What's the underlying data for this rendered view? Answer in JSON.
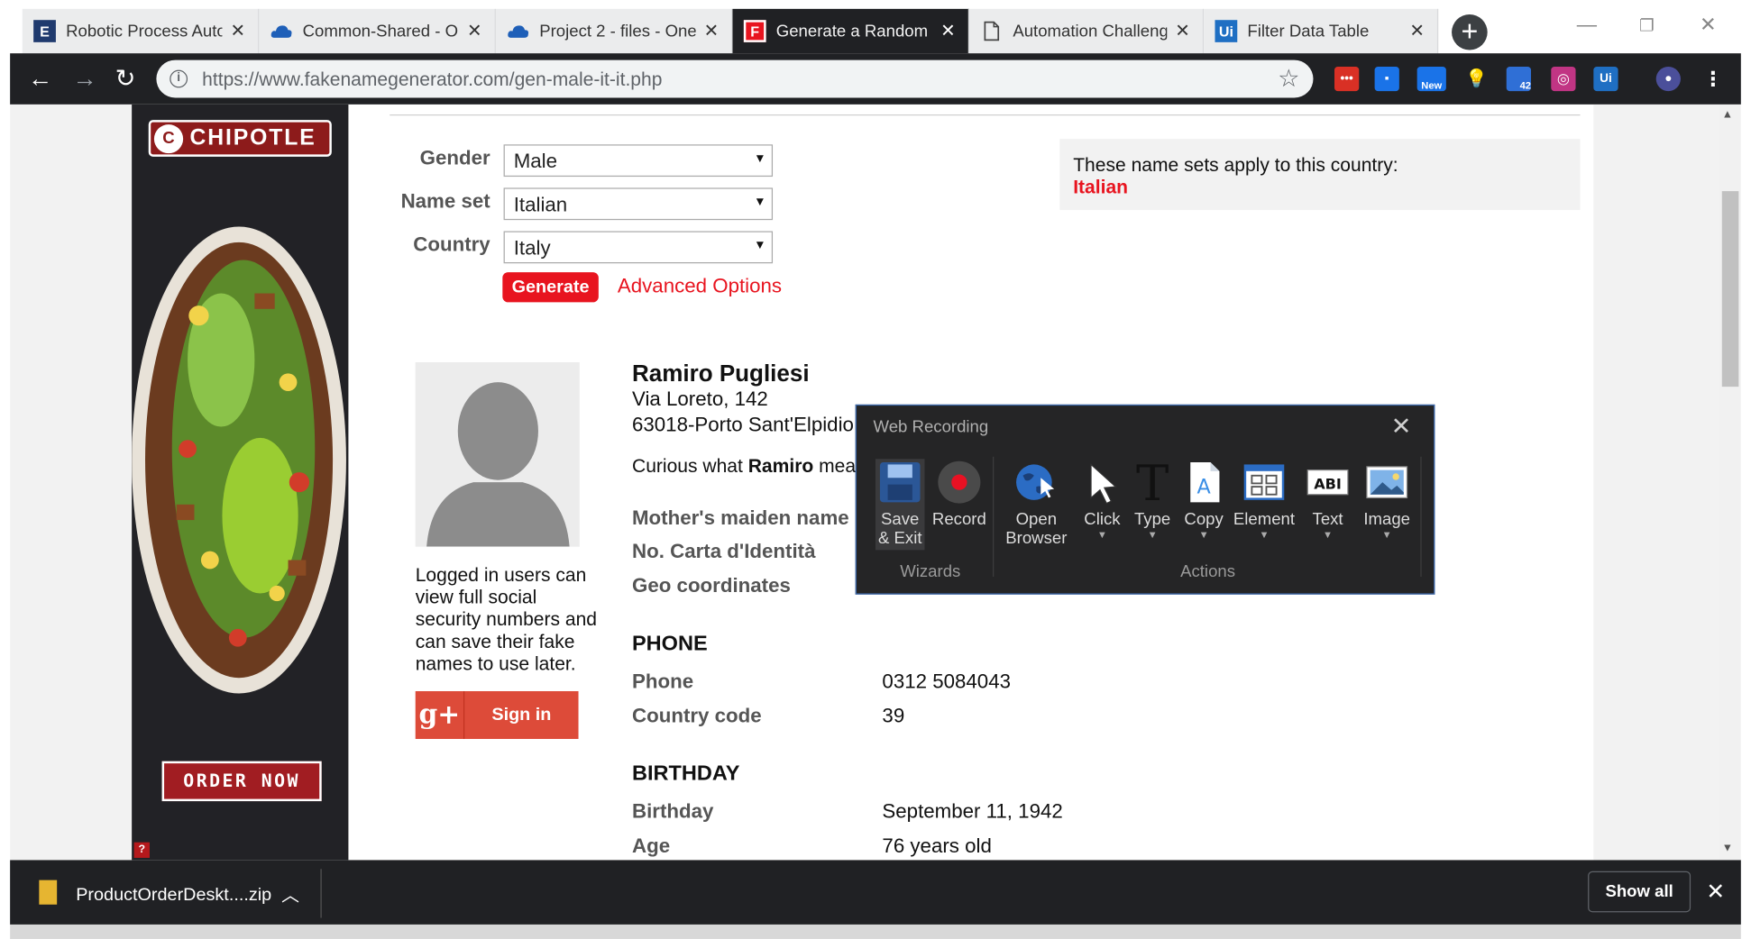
{
  "browser": {
    "tabs": [
      {
        "icon": "E",
        "title": "Robotic Process Auto",
        "active": false
      },
      {
        "icon": "cloud",
        "title": "Common-Shared - O",
        "active": false
      },
      {
        "icon": "cloud",
        "title": "Project 2 - files - One",
        "active": false
      },
      {
        "icon": "F",
        "title": "Generate a Random",
        "active": true
      },
      {
        "icon": "doc",
        "title": "Automation Challeng",
        "active": false
      },
      {
        "icon": "Ui",
        "title": "Filter Data Table",
        "active": false
      }
    ],
    "url_host": "https://www.fakenamegenerator.com",
    "url_path": "/gen-male-it-it.php",
    "ext_badges": {
      "new": "New",
      "count": "42",
      "ui": "Ui"
    }
  },
  "ad": {
    "brand": "CHIPOTLE",
    "cta": "ORDER NOW",
    "badge": "?"
  },
  "form": {
    "gender_label": "Gender",
    "gender_value": "Male",
    "nameset_label": "Name set",
    "nameset_value": "Italian",
    "country_label": "Country",
    "country_value": "Italy",
    "generate_label": "Generate",
    "advanced_label": "Advanced Options"
  },
  "info_box": {
    "line1": "These name sets apply to this country:",
    "line2": "Italian"
  },
  "sidebar": {
    "logged_text": "Logged in users can view full social security numbers and can save their fake names to use later.",
    "signin_label": "Sign in",
    "gplus_mark": "g+"
  },
  "person": {
    "name": "Ramiro Pugliesi",
    "address1": "Via Loreto, 142",
    "address2": "63018-Porto Sant'Elpidio",
    "curious_prefix": "Curious what ",
    "curious_name": "Ramiro",
    "curious_suffix": " mea",
    "rows": [
      {
        "label": "Mother's maiden name"
      },
      {
        "label": "No. Carta d'Identità"
      },
      {
        "label": "Geo coordinates"
      }
    ],
    "phone_heading": "PHONE",
    "phone_label": "Phone",
    "phone_value": "0312 5084043",
    "cc_label": "Country code",
    "cc_value": "39",
    "birthday_heading": "BIRTHDAY",
    "birthday_label": "Birthday",
    "birthday_value": "September 11, 1942",
    "age_label": "Age",
    "age_value": "76 years old"
  },
  "recorder": {
    "title": "Web Recording",
    "items": {
      "save": "Save\n& Exit",
      "record": "Record",
      "open": "Open\nBrowser",
      "click": "Click",
      "type": "Type",
      "copy": "Copy",
      "element": "Element",
      "text": "Text",
      "image": "Image"
    },
    "group_wizards": "Wizards",
    "group_actions": "Actions",
    "record_color": "#e81123"
  },
  "downloads": {
    "file": "ProductOrderDeskt....zip",
    "show_all": "Show all"
  },
  "colors": {
    "brand_red": "#e8141f",
    "chrome_dark": "#202124",
    "ad_bg": "#222226"
  }
}
